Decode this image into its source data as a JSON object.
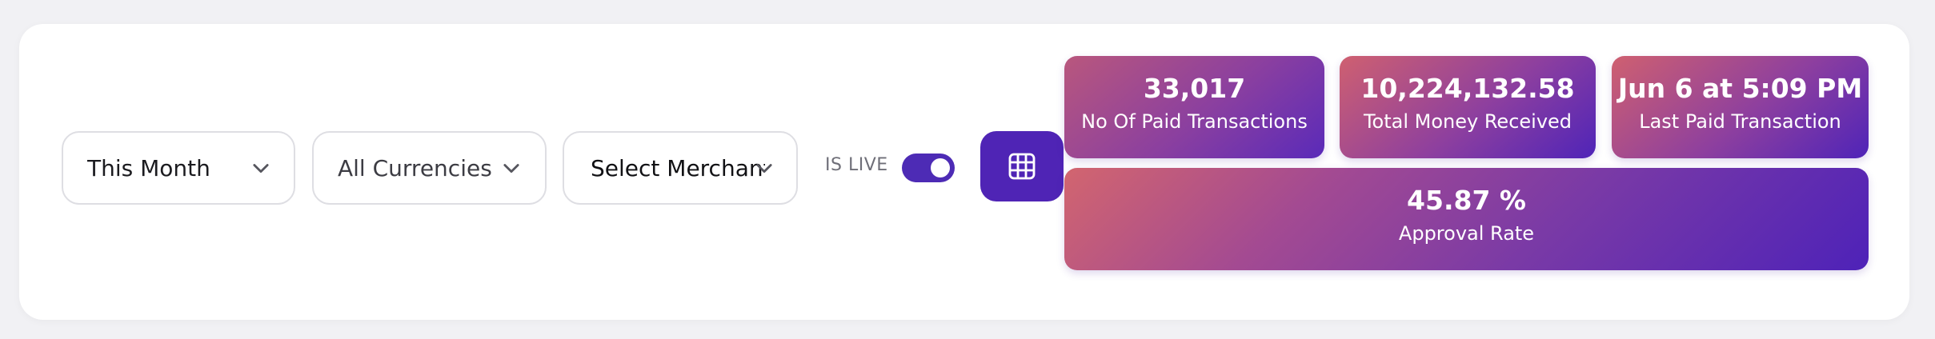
{
  "filters": {
    "period": "This Month",
    "currency": "All Currencies",
    "merchant": "Select Merchant"
  },
  "live_toggle": {
    "label": "IS LIVE",
    "state": "on"
  },
  "stats": [
    {
      "value": "33,017",
      "label": "No Of Paid Transactions"
    },
    {
      "value": "10,224,132.58",
      "label": "Total Money Received"
    },
    {
      "value": "Jun 6 at 5:09 PM",
      "label": "Last Paid Transaction"
    }
  ],
  "approval": {
    "value": "45.87 %",
    "label": "Approval Rate"
  },
  "colors": {
    "accent": "#4f24b5",
    "gradient_start": "#d2656f",
    "gradient_end": "#4e22b8"
  },
  "icons": {
    "dropdown": "chevron-down-icon",
    "table_view": "grid-icon"
  }
}
